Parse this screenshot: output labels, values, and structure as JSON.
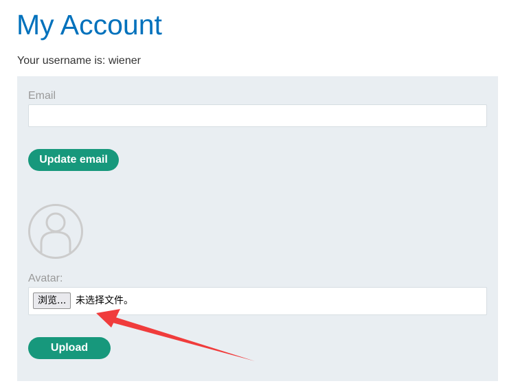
{
  "page": {
    "title": "My Account",
    "username_line": "Your username is: wiener"
  },
  "email_form": {
    "label": "Email",
    "value": "",
    "button_label": "Update email"
  },
  "avatar_form": {
    "avatar_icon": "user-silhouette-icon",
    "label": "Avatar:",
    "browse_label": "浏览...",
    "file_status": "未选择文件。",
    "upload_label": "Upload"
  },
  "annotation": {
    "arrow_color": "#f03c3c",
    "arrow_icon": "red-arrow-pointing-to-file-input"
  },
  "colors": {
    "title": "#0071bc",
    "button": "#17987c",
    "panel": "#e9eef2",
    "label": "#999999"
  }
}
